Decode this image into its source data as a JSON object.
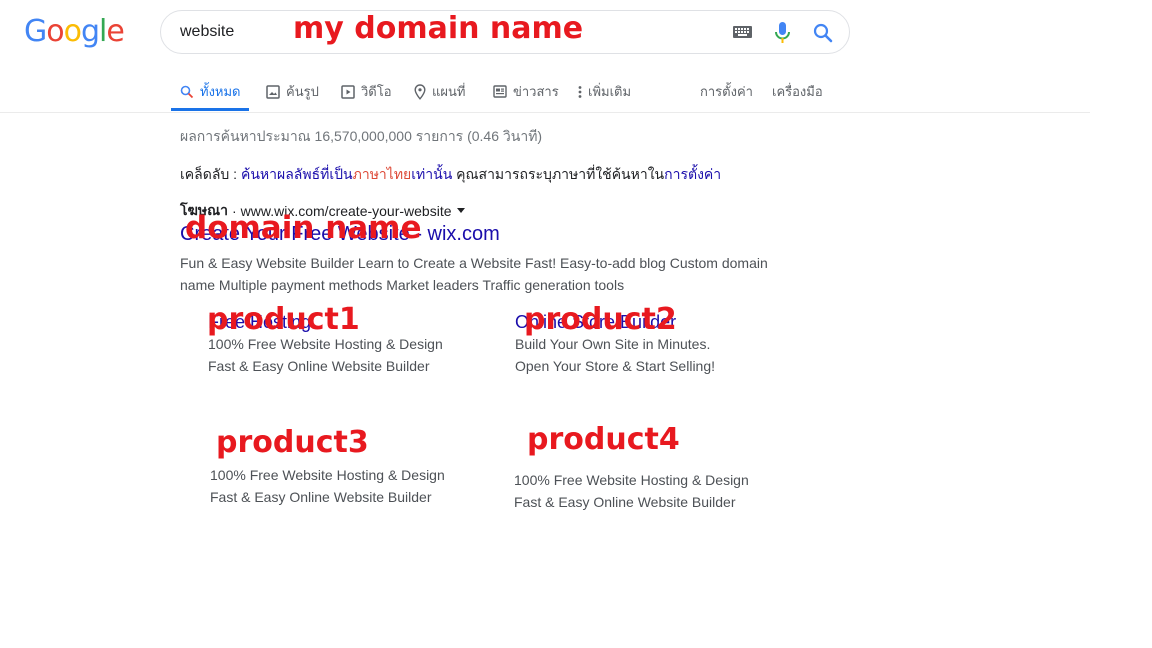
{
  "logo": {
    "letters": [
      "G",
      "o",
      "o",
      "g",
      "l",
      "e"
    ],
    "colors": [
      "#4285f4",
      "#ea4335",
      "#fbbc05",
      "#4285f4",
      "#34a853",
      "#ea4335"
    ]
  },
  "search": {
    "query": "website"
  },
  "tabs": [
    {
      "label": "ทั้งหมด",
      "icon": "search-icon",
      "active": true
    },
    {
      "label": "ค้นรูป",
      "icon": "image-icon"
    },
    {
      "label": "วิดีโอ",
      "icon": "video-icon"
    },
    {
      "label": "แผนที่",
      "icon": "map-pin-icon"
    },
    {
      "label": "ข่าวสาร",
      "icon": "news-icon"
    },
    {
      "label": "เพิ่มเติม",
      "icon": "more-vert-icon"
    }
  ],
  "tools": {
    "settings": "การตั้งค่า",
    "tools": "เครื่องมือ"
  },
  "results": {
    "stats": "ผลการค้นหาประมาณ 16,570,000,000 รายการ (0.46 วินาที)",
    "tip": {
      "prefix": "เคล็ดลับ : ",
      "link1": "ค้นหาผลลัพธ์ที่เป็น",
      "red": "ภาษาไทย",
      "link2": "เท่านั้น",
      "middle": " คุณสามารถระบุภาษาที่ใช้ค้นหาใน",
      "link3": "การตั้งค่า"
    },
    "ad": {
      "badge": "โฆษณา",
      "sep": "·",
      "url": "www.wix.com/create-your-website",
      "title": "Create Your Free Website - wix.com",
      "desc1": "Fun & Easy Website Builder Learn to Create a Website Fast! Easy-to-add blog Custom domain",
      "desc2": "name Multiple payment methods Market leaders Traffic generation tools"
    },
    "sitelinks": [
      {
        "title": "Free Hosting",
        "line1": "100% Free Website Hosting & Design",
        "line2": "Fast & Easy Online Website Builder"
      },
      {
        "title": "Online Store Builder",
        "line1": "Build Your Own Site in Minutes.",
        "line2": "Open Your Store & Start Selling!"
      },
      {
        "title": "",
        "line1": "100% Free Website Hosting & Design",
        "line2": "Fast & Easy Online Website Builder"
      },
      {
        "title": "",
        "line1": "100% Free Website Hosting & Design",
        "line2": "Fast & Easy Online Website Builder"
      }
    ]
  },
  "annotations": {
    "my_domain": "my domain name",
    "domain": "domain name",
    "product1": "product1",
    "product2": "product2",
    "product3": "product3",
    "product4": "product4"
  },
  "colors": {
    "accent": "#1a73e8",
    "link": "#1a0dab",
    "annotation": "#e8191f"
  }
}
